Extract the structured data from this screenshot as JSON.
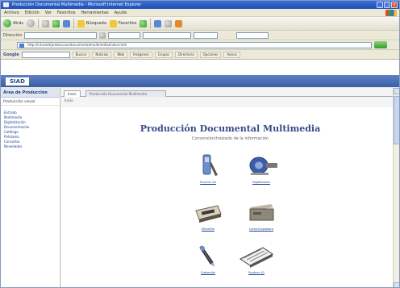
{
  "window": {
    "title": "Producción Documental Multimedia - Microsoft Internet Explorer",
    "controls": [
      "_",
      "□",
      "×"
    ]
  },
  "menu": {
    "items": [
      "Archivo",
      "Edición",
      "Ver",
      "Favoritos",
      "Herramientas",
      "Ayuda"
    ]
  },
  "toolbar": {
    "back_label": "Atrás",
    "search_label": "Búsqueda",
    "favorites_label": "Favoritos"
  },
  "address": {
    "label": "Dirección",
    "url": "http://intranet/produccion/documental/multimedia/index.html",
    "go_label": "Ir"
  },
  "googlebar": {
    "label": "Google",
    "buttons": [
      "Buscar",
      "Noticias",
      "Web",
      "Imágenes",
      "Grupos",
      "Directorio",
      "Opciones",
      "Avisos"
    ]
  },
  "portal": {
    "logo": "SIAD"
  },
  "sidebar": {
    "header": "Área de Producción",
    "subheader": "Producción visual",
    "links": [
      "Entrada",
      "Multimedia",
      "Digitalización",
      "Documentación",
      "Catálogo",
      "Préstamo",
      "Consultas",
      "Novedades"
    ]
  },
  "tabs": [
    {
      "label": "Inicio",
      "active": true
    },
    {
      "label": "Producción Documental Multimedia",
      "active": false
    }
  ],
  "breadcrumb": "Inicio",
  "main": {
    "title": "Producción Documental Multimedia",
    "subtitle": "Conversión/traslado de la información"
  },
  "items": [
    {
      "caption": "Escáner A4"
    },
    {
      "caption": "Digitalizador"
    },
    {
      "caption": "Microfilm"
    },
    {
      "caption": "Lector/Copiadora"
    },
    {
      "caption": "Grabación"
    },
    {
      "caption": "Escáner A3"
    }
  ],
  "colors": {
    "titlebar": "#1f4fb5",
    "portalbar": "#3a5ea6",
    "heading": "#3a4a8a",
    "link": "#1a3f8f"
  }
}
